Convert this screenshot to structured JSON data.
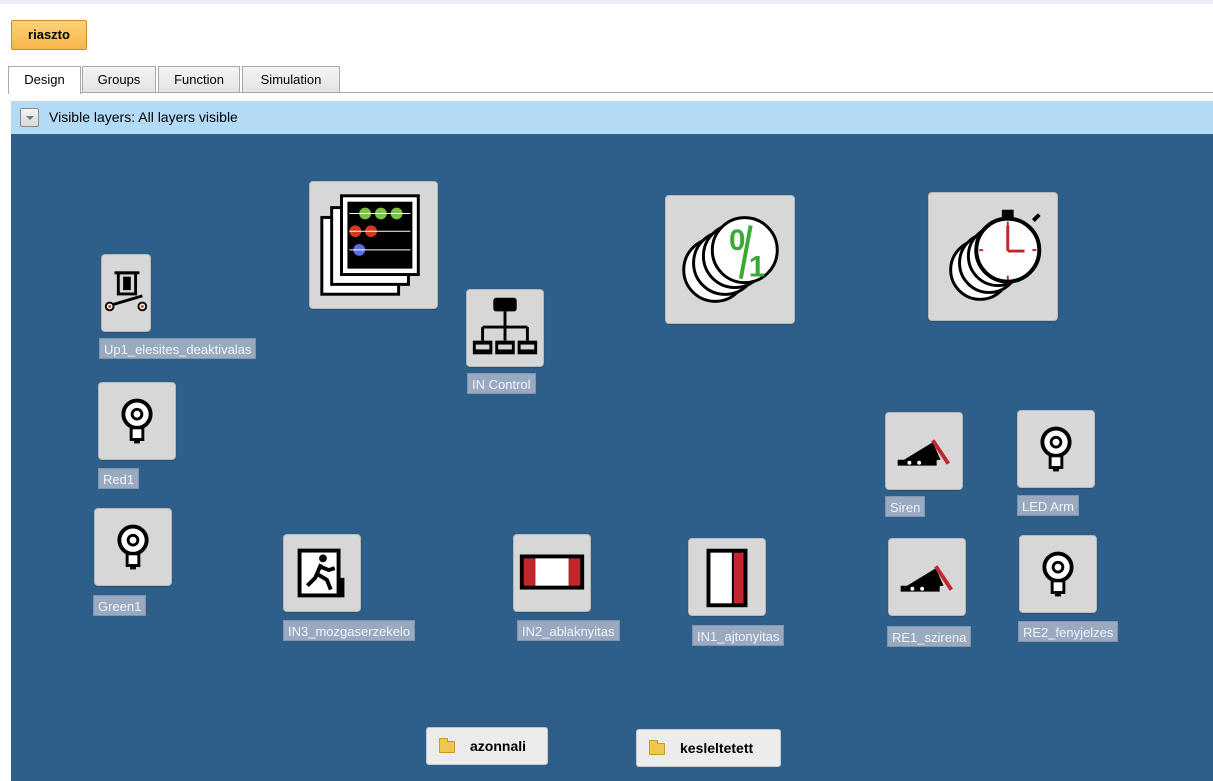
{
  "project": {
    "name": "riaszto"
  },
  "tabs": [
    {
      "label": "Design",
      "active": true
    },
    {
      "label": "Groups",
      "active": false
    },
    {
      "label": "Function",
      "active": false
    },
    {
      "label": "Simulation",
      "active": false
    }
  ],
  "layers": {
    "label": "Visible layers:",
    "value": "All layers visible"
  },
  "devices": {
    "logic": {
      "icon": "logic-matrix-icon"
    },
    "up1": {
      "label": "Up1_elesites_deaktivalas",
      "icon": "pushbutton-icon"
    },
    "in_control": {
      "label": "IN Control",
      "icon": "network-controller-icon"
    },
    "binary": {
      "icon": "binary-value-icon",
      "text": "0/1"
    },
    "timer": {
      "icon": "stopwatch-timer-icon"
    },
    "red1": {
      "label": "Red1",
      "icon": "lamp-icon"
    },
    "green1": {
      "label": "Green1",
      "icon": "lamp-icon"
    },
    "siren": {
      "label": "Siren",
      "icon": "siren-horn-icon"
    },
    "led_arm": {
      "label": "LED Arm",
      "icon": "lamp-icon"
    },
    "re1": {
      "label": "RE1_szirena",
      "icon": "siren-horn-icon"
    },
    "re2": {
      "label": "RE2_fenyjelzes",
      "icon": "lamp-icon"
    },
    "in3": {
      "label": "IN3_mozgaserzekelo",
      "icon": "motion-exit-icon"
    },
    "in2": {
      "label": "IN2_ablaknyitas",
      "icon": "window-sensor-icon"
    },
    "in1": {
      "label": "IN1_ajtonyitas",
      "icon": "door-sensor-icon"
    }
  },
  "folders": [
    {
      "label": "azonnali",
      "icon": "folder-icon"
    },
    {
      "label": "kesleltetett",
      "icon": "folder-icon"
    }
  ],
  "colors": {
    "canvas": "#2d5f8a",
    "layers_bar": "#b3dbf5",
    "project_tab": "#f7b648"
  }
}
